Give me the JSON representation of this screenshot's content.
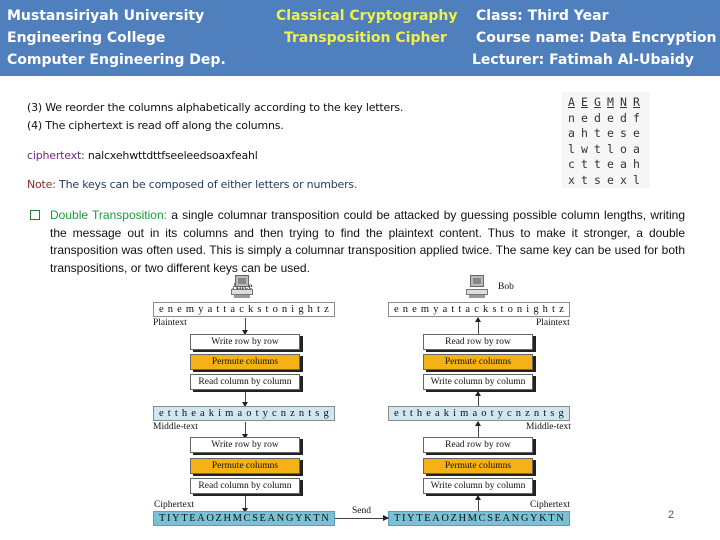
{
  "header": {
    "left": [
      "Mustansiriyah University",
      "Engineering College",
      "Computer Engineering Dep."
    ],
    "middle": [
      "Classical Cryptography",
      "Transposition Cipher"
    ],
    "right": [
      "Class: Third Year",
      "Course name: Data Encryption",
      "Lecturer: Fatimah Al-Ubaidy"
    ]
  },
  "steps": {
    "step3": "(3) We reorder the columns alphabetically according to the key letters.",
    "step4": "(4) The ciphertext is read off along the columns."
  },
  "ciphertext": {
    "label": "ciphertext:",
    "value": " nalcxehwttdttfseeleedsoaxfeahl"
  },
  "note": {
    "label": "Note:",
    "text": " The keys can be composed of either letters or numbers."
  },
  "key_table": {
    "header": [
      "A",
      "E",
      "G",
      "M",
      "N",
      "R"
    ],
    "rows": [
      [
        "n",
        "e",
        "d",
        "e",
        "d",
        "f"
      ],
      [
        "a",
        "h",
        "t",
        "e",
        "s",
        "e"
      ],
      [
        "l",
        "w",
        "t",
        "l",
        "o",
        "a"
      ],
      [
        "c",
        "t",
        "t",
        "e",
        "a",
        "h"
      ],
      [
        "x",
        "t",
        "s",
        "e",
        "x",
        "l"
      ]
    ]
  },
  "double_transposition": {
    "label": "Double Transposition:",
    "text": " a single columnar transposition could be attacked by guessing possible column lengths, writing the message out in its columns and then trying to find the plaintext content. Thus to make it stronger, a double transposition was often used. This is simply a columnar transposition applied twice. The same key can be used for both transpositions, or two different keys can be used."
  },
  "diagram": {
    "sender": "Alice",
    "receiver": "Bob",
    "plaintext_label": "Plaintext",
    "middle_label": "Middle-text",
    "ciphertext_label": "Ciphertext",
    "send_label": "Send",
    "plaintext": [
      "e",
      "n",
      "e",
      "m",
      "y",
      "a",
      "t",
      "t",
      "a",
      "c",
      "k",
      "s",
      "t",
      "o",
      "n",
      "i",
      "g",
      "h",
      "t",
      "z"
    ],
    "middletext": [
      "e",
      "t",
      "t",
      "h",
      "e",
      "a",
      "k",
      "i",
      "m",
      "a",
      "o",
      "t",
      "y",
      "c",
      "n",
      "z",
      "n",
      "t",
      "s",
      "g"
    ],
    "ciphertext": [
      "T",
      "I",
      "Y",
      "T",
      "E",
      "A",
      "O",
      "Z",
      "H",
      "M",
      "C",
      "S",
      "E",
      "A",
      "N",
      "G",
      "Y",
      "K",
      "T",
      "N"
    ],
    "encrypt_steps": [
      "Write row by row",
      "Permute columns",
      "Read column by column"
    ],
    "decrypt_steps": [
      "Read row by row",
      "Permute columns",
      "Write column by column"
    ]
  },
  "page_number": "2"
}
